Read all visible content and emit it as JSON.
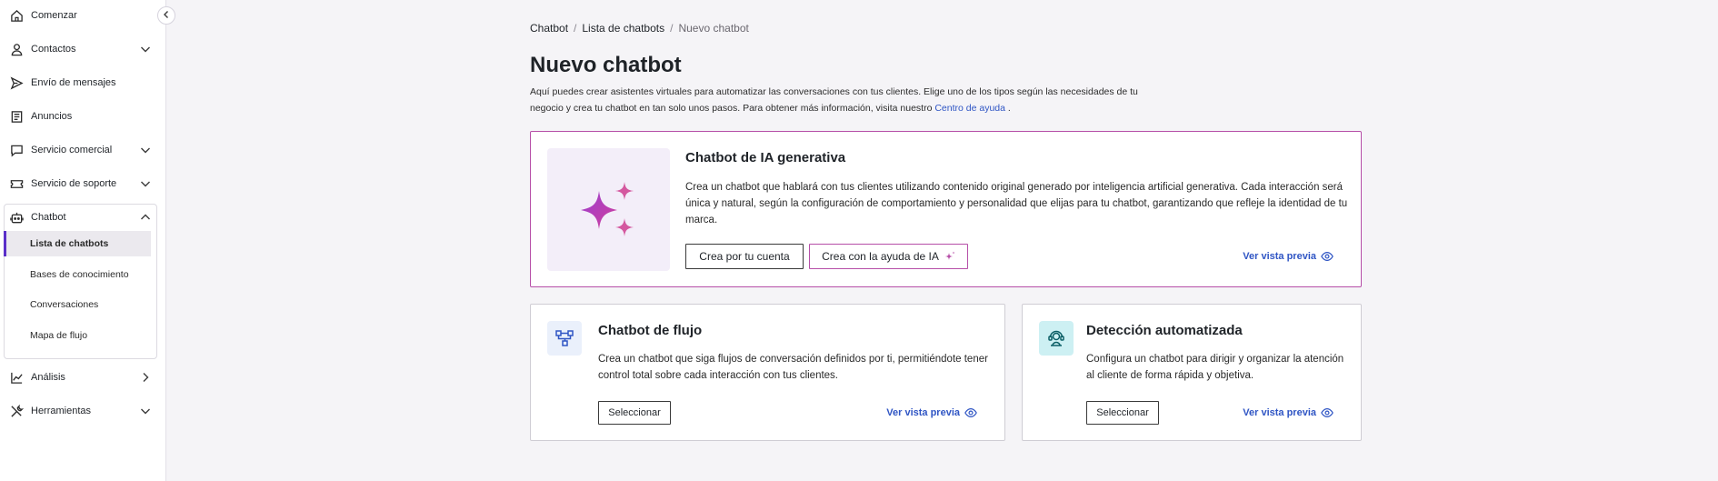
{
  "sidebar": {
    "items": [
      {
        "label": "Comenzar",
        "icon": "home-icon"
      },
      {
        "label": "Contactos",
        "icon": "user-icon"
      },
      {
        "label": "Envío de mensajes",
        "icon": "send-icon"
      },
      {
        "label": "Anuncios",
        "icon": "newspaper-icon"
      },
      {
        "label": "Servicio comercial",
        "icon": "chat-icon"
      },
      {
        "label": "Servicio de soporte",
        "icon": "ticket-icon"
      },
      {
        "label": "Chatbot",
        "icon": "robot-icon"
      },
      {
        "label": "Análisis",
        "icon": "chart-line-icon"
      },
      {
        "label": "Herramientas",
        "icon": "tools-icon"
      }
    ],
    "chatbot_sub": [
      {
        "label": "Lista de chatbots",
        "active": true
      },
      {
        "label": "Bases de conocimiento"
      },
      {
        "label": "Conversaciones"
      },
      {
        "label": "Mapa de flujo"
      }
    ]
  },
  "breadcrumb": {
    "items": [
      "Chatbot",
      "Lista de chatbots",
      "Nuevo chatbot"
    ],
    "separator": "/"
  },
  "page": {
    "title": "Nuevo chatbot",
    "description": "Aquí puedes crear asistentes virtuales para automatizar las conversaciones con tus clientes. Elige uno de los tipos según las necesidades de tu negocio y crea tu chatbot en tan solo unos pasos. Para obtener más información, visita nuestro ",
    "help_link": "Centro de ayuda",
    "description_end": " ."
  },
  "cards": {
    "ai": {
      "title": "Chatbot de IA generativa",
      "text": "Crea un chatbot que hablará con tus clientes utilizando contenido original generado por inteligencia artificial generativa. Cada interacción será única y natural, según la configuración de comportamiento y personalidad que elijas para tu chatbot, garantizando que refleje la identidad de tu marca.",
      "btn_manual": "Crea por tu cuenta",
      "btn_ai": "Crea con la ayuda de IA",
      "preview": "Ver vista previa"
    },
    "flow": {
      "title": "Chatbot de flujo",
      "text": "Crea un chatbot que siga flujos de conversación definidos por ti, permitiéndote tener control total sobre cada interacción con tus clientes.",
      "btn": "Seleccionar",
      "preview": "Ver vista previa"
    },
    "detect": {
      "title": "Detección automatizada",
      "text": "Configura un chatbot para dirigir y organizar la atención al cliente de forma rápida y objetiva.",
      "btn": "Seleccionar",
      "preview": "Ver vista previa"
    }
  },
  "colors": {
    "accent": "#5a2fc9",
    "ai_border": "#b64fa8",
    "link": "#2f55c4",
    "flow_icon_bg": "#eaf0fb",
    "detect_icon_bg": "#cdf0f3"
  }
}
